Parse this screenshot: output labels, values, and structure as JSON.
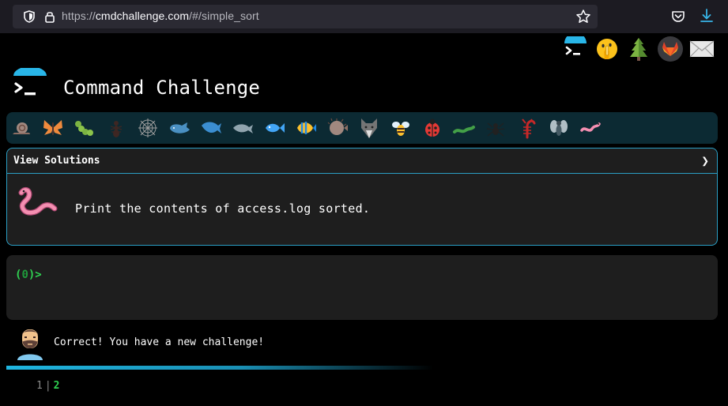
{
  "browser": {
    "url_prefix": "https://",
    "url_domain": "cmdchallenge.com",
    "url_path": "/#/simple_sort"
  },
  "top_icons": [
    "terminal-logo-icon",
    "emoji-shush-icon",
    "tree-icon",
    "gitlab-icon",
    "envelope-icon"
  ],
  "app": {
    "title": "Command Challenge"
  },
  "animals": [
    "snail",
    "butterfly",
    "caterpillar",
    "ant",
    "spider-web",
    "whale",
    "dolphin",
    "dolphin-2",
    "fish",
    "tropical-fish",
    "blowfish",
    "wolf",
    "bee",
    "ladybug",
    "worm-green",
    "spider",
    "scorpion",
    "fly",
    "earthworm"
  ],
  "challenge": {
    "solutions_label": "View Solutions",
    "chevron": "❯",
    "task": "Print the contents of access.log sorted."
  },
  "terminal": {
    "prompt_open": "(",
    "prompt_code": "0",
    "prompt_close": ")>",
    "input_value": ""
  },
  "feedback": {
    "message": "Correct! You have a new challenge!",
    "progress": 1.0
  },
  "pager": {
    "previous": "1",
    "separator": "|",
    "current": "2"
  },
  "colors": {
    "accent": "#2b9fc5",
    "prompt_green": "#2fd151",
    "panel_bg": "#1e1e1e",
    "strip_bg": "#0c2a33"
  }
}
